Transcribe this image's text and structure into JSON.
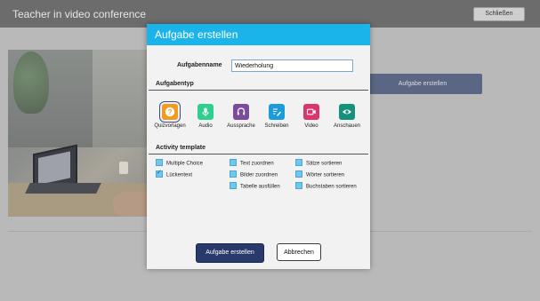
{
  "window": {
    "title": "Teacher in video conference",
    "close_label": "Schließen"
  },
  "background": {
    "create_task_label": "Aufgabe erstellen"
  },
  "dialog": {
    "title": "Aufgabe erstellen",
    "name_label": "Aufgabenname",
    "name_value": "Wiederholung",
    "type_section": "Aufgabentyp",
    "types": [
      {
        "label": "Quizvorlagen",
        "icon": "question-icon",
        "color": "#f39b1f",
        "selected": true
      },
      {
        "label": "Audio",
        "icon": "microphone-icon",
        "color": "#2fcf8e",
        "selected": false
      },
      {
        "label": "Aussprache",
        "icon": "headset-icon",
        "color": "#7b4b9e",
        "selected": false
      },
      {
        "label": "Schreiben",
        "icon": "pen-icon",
        "color": "#1d9ad8",
        "selected": false
      },
      {
        "label": "Video",
        "icon": "video-icon",
        "color": "#d9356f",
        "selected": false
      },
      {
        "label": "Anschauen",
        "icon": "eye-icon",
        "color": "#15917c",
        "selected": false
      }
    ],
    "template_section": "Activity template",
    "templates": {
      "col1": [
        {
          "label": "Multiple Choice",
          "checked": false
        },
        {
          "label": "Lückentext",
          "checked": true
        }
      ],
      "col2": [
        {
          "label": "Text zuordnen",
          "checked": false
        },
        {
          "label": "Bilder zuordnen",
          "checked": false
        },
        {
          "label": "Tabelle ausfüllen",
          "checked": false
        }
      ],
      "col3": [
        {
          "label": "Sätze sortieren",
          "checked": false
        },
        {
          "label": "Wörter sortieren",
          "checked": false
        },
        {
          "label": "Buchstaben sortieren",
          "checked": false
        }
      ]
    },
    "create_button": "Aufgabe erstellen",
    "cancel_button": "Abbrechen"
  }
}
